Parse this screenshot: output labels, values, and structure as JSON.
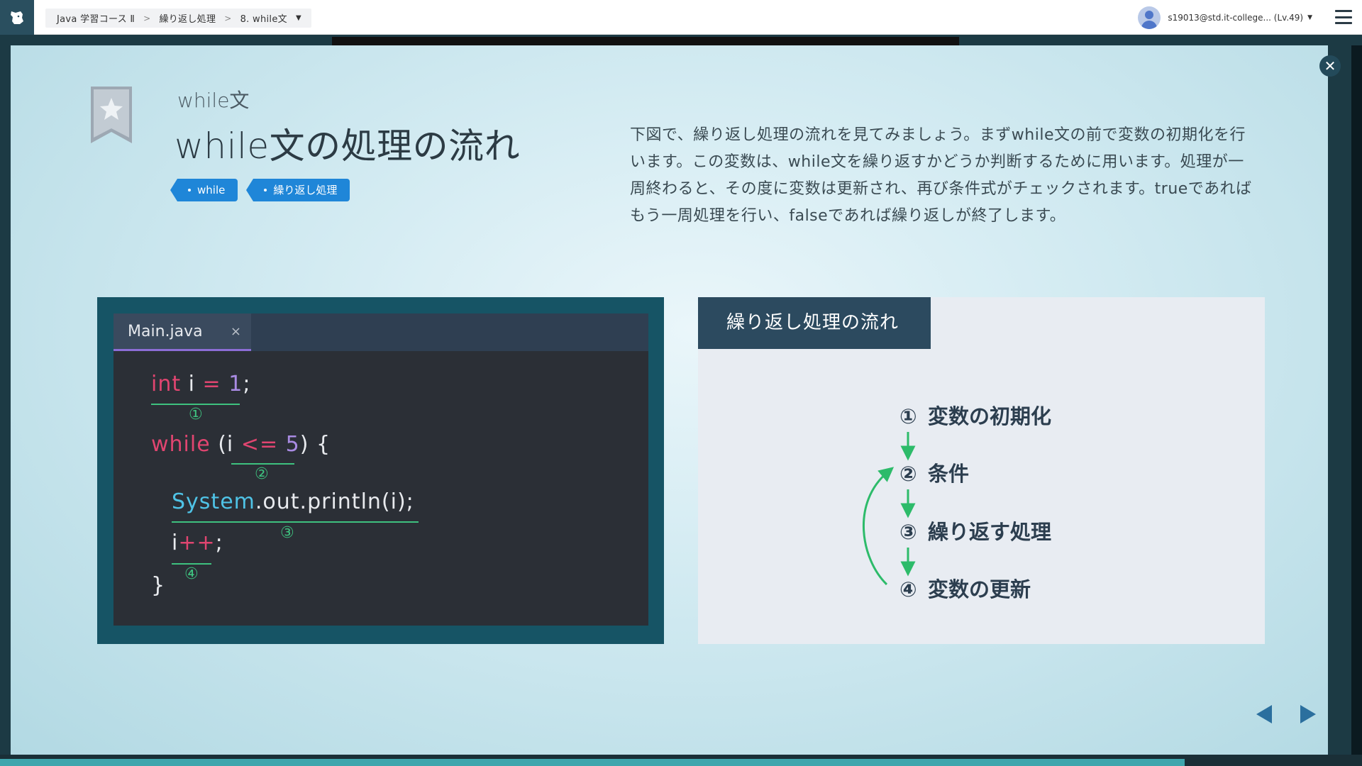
{
  "header": {
    "breadcrumb": [
      "Java 学習コース Ⅱ",
      "繰り返し処理",
      "8. while文"
    ],
    "user": "s19013@std.it-college... (Lv.49)",
    "logo_icon": "dog-logo-icon",
    "menu_icon": "hamburger-icon"
  },
  "lesson": {
    "subtitle": "while文",
    "title": "while文の処理の流れ",
    "tags": [
      "while",
      "繰り返し処理"
    ],
    "description": "下図で、繰り返し処理の流れを見てみましょう。まずwhile文の前で変数の初期化を行います。この変数は、while文を繰り返すかどうか判断するために用います。処理が一周終わると、その度に変数は更新され、再び条件式がチェックされます。trueであればもう一周処理を行い、falseであれば繰り返しが終了します。"
  },
  "editor": {
    "tab_label": "Main.java",
    "close_symbol": "×",
    "lines": {
      "l1": {
        "kw": "int",
        "var": " i ",
        "op": "=",
        "num": " 1",
        "end": ";"
      },
      "l2": {
        "kw": "while",
        "open": " (i ",
        "op": "<=",
        "num": " 5",
        "close": ") {"
      },
      "l3": {
        "cls": "System",
        "rest": ".out.println(i);"
      },
      "l4": {
        "var": "i",
        "op": "++",
        "end": ";"
      },
      "l5": "}"
    },
    "markers": [
      "①",
      "②",
      "③",
      "④"
    ]
  },
  "flow": {
    "header": "繰り返し処理の流れ",
    "steps": [
      {
        "num": "①",
        "label": "変数の初期化"
      },
      {
        "num": "②",
        "label": "条件"
      },
      {
        "num": "③",
        "label": "繰り返す処理"
      },
      {
        "num": "④",
        "label": "変数の更新"
      }
    ],
    "arrow_color": "#2dbb6a"
  },
  "colors": {
    "accent_tag": "#1f86d8",
    "keyword": "#e04570",
    "number": "#a98be3",
    "class": "#4fc3e6",
    "marker": "#3ec17f"
  }
}
